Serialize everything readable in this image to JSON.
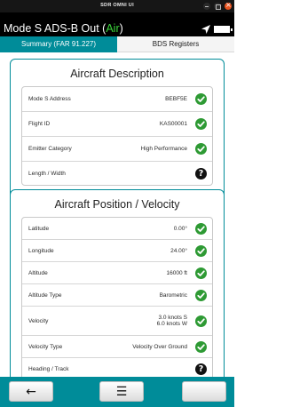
{
  "window": {
    "title": "SDR OMNI UI"
  },
  "header": {
    "title_prefix": "Mode S ADS-B Out (",
    "title_status": "Air",
    "title_suffix": ")"
  },
  "tabs": [
    {
      "label": "Summary (FAR 91.227)",
      "active": true
    },
    {
      "label": "BDS Registers",
      "active": false
    }
  ],
  "sections": {
    "description": {
      "title": "Aircraft Description",
      "rows": [
        {
          "label": "Mode S Address",
          "value": "BEBF5E",
          "status": "ok"
        },
        {
          "label": "Flight ID",
          "value": "KAS00001",
          "status": "ok"
        },
        {
          "label": "Emitter Category",
          "value": "High Performance",
          "status": "ok"
        },
        {
          "label": "Length / Width",
          "value": "",
          "status": "unknown"
        }
      ]
    },
    "position": {
      "title": "Aircraft Position / Velocity",
      "rows": [
        {
          "label": "Latitude",
          "value": "0.00°",
          "status": "ok"
        },
        {
          "label": "Longitude",
          "value": "24.00°",
          "status": "ok"
        },
        {
          "label": "Altitude",
          "value": "16000 ft",
          "status": "ok"
        },
        {
          "label": "Altitude Type",
          "value": "Barometric",
          "status": "ok"
        },
        {
          "label": "Velocity",
          "value_line1": "3.0 knots S",
          "value_line2": "6.0 knots W",
          "status": "ok"
        },
        {
          "label": "Velocity Type",
          "value": "Velocity Over Ground",
          "status": "ok"
        },
        {
          "label": "Heading / Track",
          "value": "",
          "status": "unknown"
        }
      ]
    }
  },
  "status_icons": {
    "ok": "check-circle-icon",
    "unknown": "question-circle-icon"
  },
  "bottom_bar": {
    "back_icon": "←",
    "menu_icon": "☰"
  },
  "colors": {
    "accent": "#008c99",
    "air_status": "#3cd63c",
    "ok_status": "#2e9a34",
    "header_bg": "#000000",
    "close_button": "#e95420"
  }
}
